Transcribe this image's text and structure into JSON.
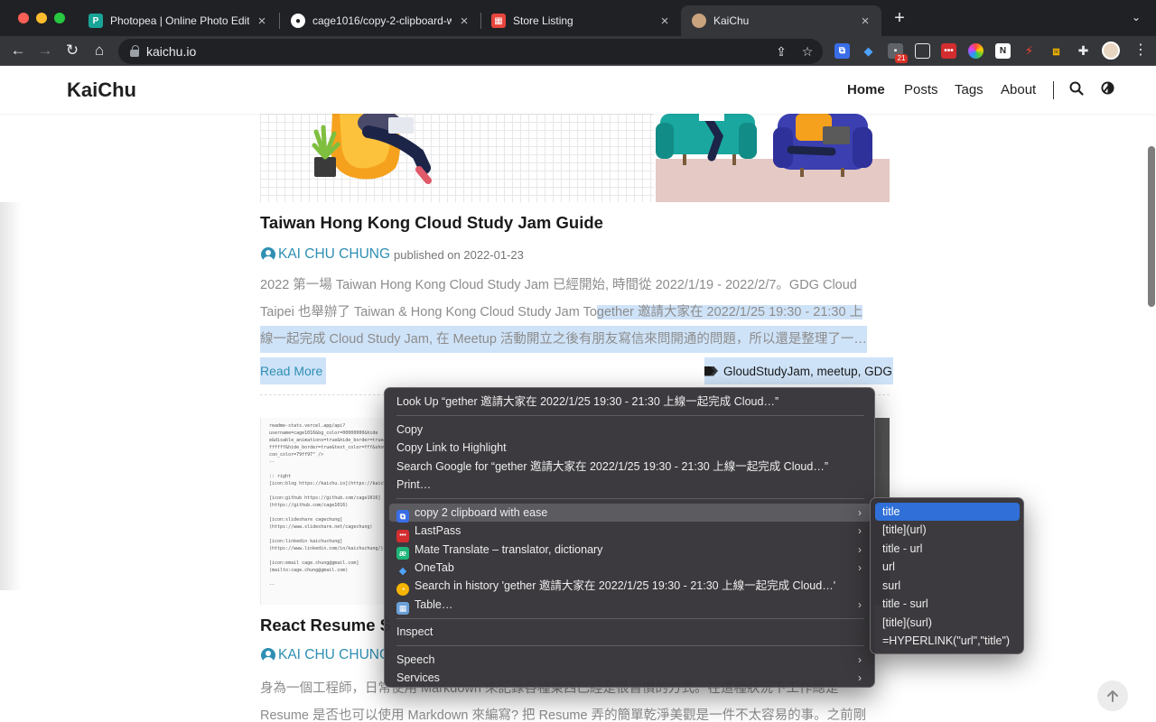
{
  "tabs": [
    {
      "label": "Photopea | Online Photo Editor",
      "icon": "photopea-icon",
      "color": "#18a497"
    },
    {
      "label": "cage1016/copy-2-clipboard-wi",
      "icon": "github-icon",
      "color": "#ffffff"
    },
    {
      "label": "Store Listing",
      "icon": "store-icon",
      "color": "#e8453c"
    },
    {
      "label": "KaiChu",
      "icon": "avatar-icon",
      "color": "#c9a27e"
    }
  ],
  "address_bar": {
    "url": "kaichu.io"
  },
  "extensions": {
    "badge_count": "21"
  },
  "site": {
    "logo": "KaiChu",
    "nav": [
      "Home",
      "Posts",
      "Tags",
      "About"
    ]
  },
  "post1": {
    "title": "Taiwan Hong Kong Cloud Study Jam Guide",
    "author": "KAI CHU CHUNG",
    "published": "published on 2022-01-23",
    "excerpt_line1": "2022 第一場 Taiwan Hong Kong Cloud Study Jam 已經開始, 時間從 2022/1/19 - 2022/2/7。GDG Cloud",
    "excerpt_line2a": "Taipei 也舉辦了 Taiwan & Hong Kong Cloud Study Jam To",
    "excerpt_line2b": "gether 邀請大家在 2022/1/25 19:30 - 21:30 上",
    "excerpt_line3": "線一起完成 Cloud Study Jam, 在 Meetup 活動開立之後有朋友寫信來問開通的問題，所以還是整理了一…",
    "read_more": "Read More",
    "tags": "GloudStudyJam, meetup, GDG"
  },
  "code_image": {
    "lines": [
      "readme-stats.vercel.app/api?",
      "username=cage1016&bg_color=00000000&hide",
      "e&disable_animations=true&hide_border=true&",
      "ffffff&hide_border=true&text_color=fff&show_ic",
      "con_color=79ff97\" />",
      "--",
      "",
      ":: right",
      "[icon:blog https://kaichu.io](https://kaichu.io)",
      "",
      "[icon:github https://github.com/cage1016]",
      "(https://github.com/cage1016)",
      "",
      "[icon:slideshare cagechung]",
      "(https://www.slideshare.net/cagechung)",
      "",
      "[icon:linkedin kaichuchung]",
      "(https://www.linkedin.com/in/kaichuchung/)",
      "",
      "[icon:email cage.chung@gmail.com]",
      "(mailto:cage.chung@gmail.com)",
      "",
      "--"
    ]
  },
  "post2": {
    "title": "React Resume S",
    "author": "KAI CHU CHUNG",
    "excerpt_line1": "身為一個工程師，日常使用 Markdown 來記錄各種東西已經是很習慣的方式。在這種狀況下工作總是",
    "excerpt_line2": "Resume 是否也可以使用 Markdown 來編寫? 把 Resume 弄的簡單乾淨美觀是一件不太容易的事。之前剛"
  },
  "context_menu": {
    "look_up": "Look Up “gether 邀請大家在 2022/1/25 19:30 - 21:30 上線一起完成 Cloud…”",
    "copy": "Copy",
    "copy_link": "Copy Link to Highlight",
    "search_google": "Search Google for “gether 邀請大家在 2022/1/25 19:30 - 21:30 上線一起完成 Cloud…”",
    "print": "Print…",
    "copy2clipboard": "copy 2 clipboard with ease",
    "lastpass": "LastPass",
    "mate": "Mate Translate – translator, dictionary",
    "onetab": "OneTab",
    "search_history": "Search in history 'gether 邀請大家在 2022/1/25 19:30 - 21:30 上線一起完成 Cloud…'",
    "table": "Table…",
    "inspect": "Inspect",
    "speech": "Speech",
    "services": "Services"
  },
  "submenu": [
    "title",
    "[title](url)",
    "title - url",
    "url",
    "surl",
    "title - surl",
    "[title](surl)",
    "=HYPERLINK(\"url\",\"title\")"
  ],
  "colors": {
    "accent": "#2e8fb3",
    "selection": "#cfe3f8",
    "menu_selected": "#2f6fd7"
  }
}
